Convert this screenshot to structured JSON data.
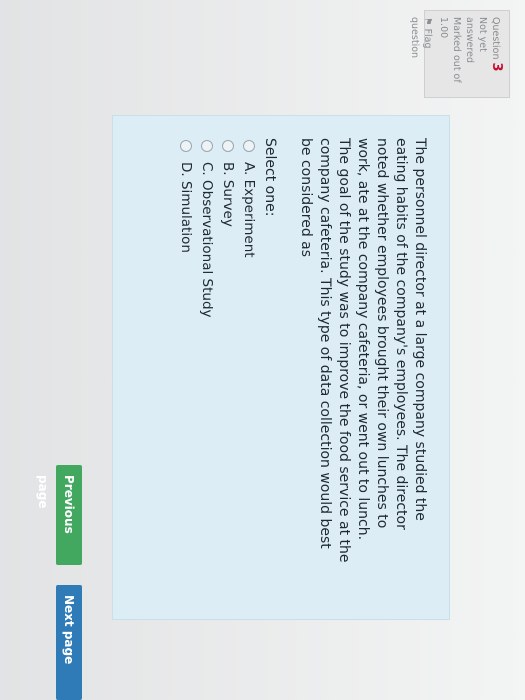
{
  "question_info": {
    "question_label": "Question",
    "question_number": "3",
    "status": "Not yet answered",
    "marked_out_of": "Marked out of 1.00",
    "flag": "Flag question"
  },
  "question": {
    "text": "The personnel director at a large company studied the eating habits of the company's employees. The director noted whether employees brought their own lunches to work, ate at the company cafeteria, or went out to lunch. The goal of the study was to improve the food service at the company cafeteria. This type of data collection would best be considered as",
    "prompt": "Select one:",
    "options": [
      "A. Experiment",
      "B. Survey",
      "C. Observational Study",
      "D. Simulation"
    ]
  },
  "navigation": {
    "previous": "Previous page",
    "next": "Next page"
  }
}
